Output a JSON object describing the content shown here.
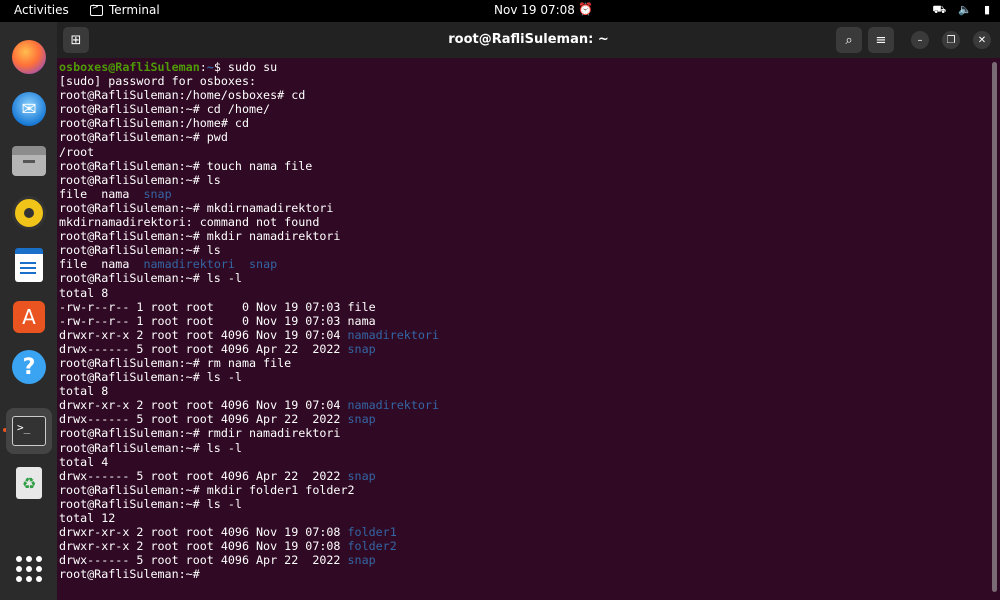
{
  "topbar": {
    "activities": "Activities",
    "app_name": "Terminal",
    "datetime": "Nov 19  07:08"
  },
  "dock": {
    "apps": [
      "firefox",
      "thunderbird",
      "files",
      "rhythmbox",
      "libreoffice-writer",
      "app-center",
      "help",
      "terminal",
      "trash",
      "show-apps"
    ],
    "running": "terminal"
  },
  "window": {
    "title": "root@RafliSuleman: ~"
  },
  "colors": {
    "terminal_bg": "#300a24",
    "user_prompt": "#4e9a06",
    "directory": "#3465a4",
    "accent": "#e95420"
  },
  "terminal": {
    "lines": [
      [
        {
          "t": "osboxes@RafliSuleman",
          "c": "u"
        },
        {
          "t": ":"
        },
        {
          "t": "~",
          "c": "p"
        },
        {
          "t": "$ sudo su"
        }
      ],
      [
        {
          "t": "[sudo] password for osboxes:"
        }
      ],
      [
        {
          "t": "root@RafliSuleman:/home/osboxes# cd"
        }
      ],
      [
        {
          "t": "root@RafliSuleman:~# cd /home/"
        }
      ],
      [
        {
          "t": "root@RafliSuleman:/home# cd"
        }
      ],
      [
        {
          "t": "root@RafliSuleman:~# pwd"
        }
      ],
      [
        {
          "t": "/root"
        }
      ],
      [
        {
          "t": "root@RafliSuleman:~# touch nama file"
        }
      ],
      [
        {
          "t": "root@RafliSuleman:~# ls"
        }
      ],
      [
        {
          "t": "file  nama  "
        },
        {
          "t": "snap",
          "c": "d"
        }
      ],
      [
        {
          "t": "root@RafliSuleman:~# mkdirnamadirektori"
        }
      ],
      [
        {
          "t": "mkdirnamadirektori: command not found"
        }
      ],
      [
        {
          "t": "root@RafliSuleman:~# mkdir namadirektori"
        }
      ],
      [
        {
          "t": "root@RafliSuleman:~# ls"
        }
      ],
      [
        {
          "t": "file  nama  "
        },
        {
          "t": "namadirektori",
          "c": "d"
        },
        {
          "t": "  "
        },
        {
          "t": "snap",
          "c": "d"
        }
      ],
      [
        {
          "t": "root@RafliSuleman:~# ls -l"
        }
      ],
      [
        {
          "t": "total 8"
        }
      ],
      [
        {
          "t": "-rw-r--r-- 1 root root    0 Nov 19 07:03 file"
        }
      ],
      [
        {
          "t": "-rw-r--r-- 1 root root    0 Nov 19 07:03 nama"
        }
      ],
      [
        {
          "t": "drwxr-xr-x 2 root root 4096 Nov 19 07:04 "
        },
        {
          "t": "namadirektori",
          "c": "d"
        }
      ],
      [
        {
          "t": "drwx------ 5 root root 4096 Apr 22  2022 "
        },
        {
          "t": "snap",
          "c": "d"
        }
      ],
      [
        {
          "t": "root@RafliSuleman:~# rm nama file"
        }
      ],
      [
        {
          "t": "root@RafliSuleman:~# ls -l"
        }
      ],
      [
        {
          "t": "total 8"
        }
      ],
      [
        {
          "t": "drwxr-xr-x 2 root root 4096 Nov 19 07:04 "
        },
        {
          "t": "namadirektori",
          "c": "d"
        }
      ],
      [
        {
          "t": "drwx------ 5 root root 4096 Apr 22  2022 "
        },
        {
          "t": "snap",
          "c": "d"
        }
      ],
      [
        {
          "t": "root@RafliSuleman:~# rmdir namadirektori"
        }
      ],
      [
        {
          "t": "root@RafliSuleman:~# ls -l"
        }
      ],
      [
        {
          "t": "total 4"
        }
      ],
      [
        {
          "t": "drwx------ 5 root root 4096 Apr 22  2022 "
        },
        {
          "t": "snap",
          "c": "d"
        }
      ],
      [
        {
          "t": "root@RafliSuleman:~# mkdir folder1 folder2"
        }
      ],
      [
        {
          "t": "root@RafliSuleman:~# ls -l"
        }
      ],
      [
        {
          "t": "total 12"
        }
      ],
      [
        {
          "t": "drwxr-xr-x 2 root root 4096 Nov 19 07:08 "
        },
        {
          "t": "folder1",
          "c": "d"
        }
      ],
      [
        {
          "t": "drwxr-xr-x 2 root root 4096 Nov 19 07:08 "
        },
        {
          "t": "folder2",
          "c": "d"
        }
      ],
      [
        {
          "t": "drwx------ 5 root root 4096 Apr 22  2022 "
        },
        {
          "t": "snap",
          "c": "d"
        }
      ],
      [
        {
          "t": "root@RafliSuleman:~# "
        }
      ]
    ]
  }
}
